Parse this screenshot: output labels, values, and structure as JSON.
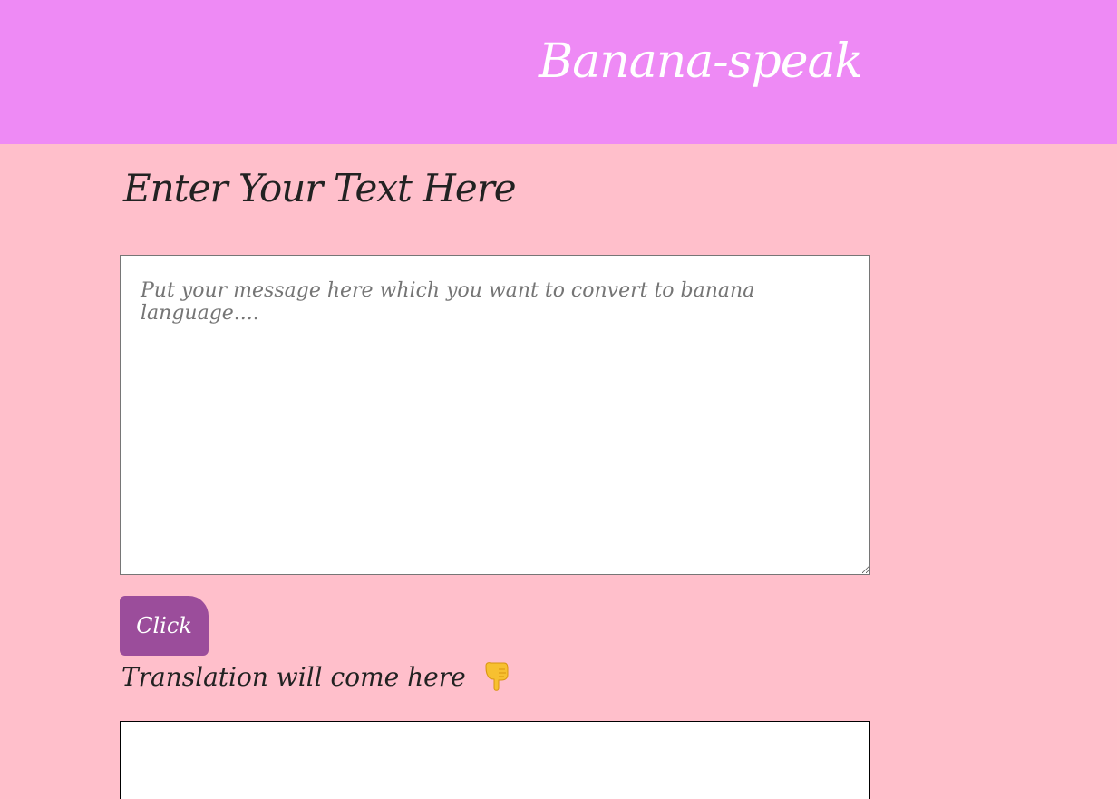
{
  "header": {
    "title": "Banana-speak"
  },
  "input_section": {
    "heading": "Enter Your Text Here",
    "textarea_placeholder": "Put your message here which you want to convert to banana language....",
    "textarea_value": ""
  },
  "button": {
    "label": "Click"
  },
  "output_section": {
    "label": "Translation will come here",
    "icon": "pointing-down-hand-icon",
    "output_text": ""
  },
  "colors": {
    "header_bg": "#ee8af5",
    "page_bg": "#ffbfcb",
    "button_bg": "#9b4d9b"
  }
}
